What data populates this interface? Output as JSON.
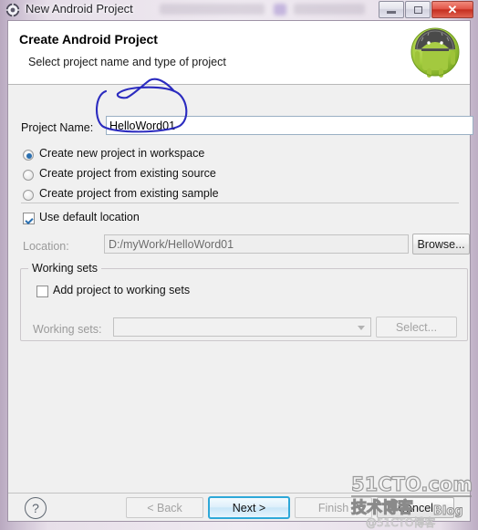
{
  "window": {
    "title": "New Android Project",
    "icon": "android-settings-icon",
    "controls": {
      "minimize": "minimize-button",
      "maximize": "maximize-button",
      "close": "✕"
    }
  },
  "header": {
    "title": "Create Android Project",
    "subtitle": "Select project name and type of project",
    "logo": "android-robot-icon"
  },
  "form": {
    "project_name_label": "Project Name:",
    "project_name_value": "HelloWord01",
    "project_name_placeholder": "",
    "radios": [
      {
        "label": "Create new project in workspace",
        "selected": true
      },
      {
        "label": "Create project from existing source",
        "selected": false
      },
      {
        "label": "Create project from existing sample",
        "selected": false
      }
    ],
    "use_default_location_label": "Use default location",
    "use_default_location_checked": true,
    "location_label": "Location:",
    "location_value": "D:/myWork/HelloWord01",
    "browse_label": "Browse...",
    "working_sets": {
      "group_title": "Working sets",
      "add_checkbox_label": "Add project to working sets",
      "add_checkbox_checked": false,
      "combo_label": "Working sets:",
      "combo_value": "",
      "select_label": "Select..."
    }
  },
  "footer": {
    "help": "?",
    "back_label": "< Back",
    "next_label": "Next >",
    "finish_label": "Finish",
    "cancel_label": "Cancel"
  },
  "watermark": {
    "line1": "51CTO.com",
    "line2": "技术博客",
    "line3": "Blog",
    "line4": "@51CTO博客"
  },
  "annotation": {
    "type": "hand-drawn-ellipse",
    "color": "#2b2bbf"
  },
  "colors": {
    "accent": "#2a6fb0",
    "next_border": "#2ea8d8",
    "android_green": "#9ccc3c",
    "frame": "#9f93a6"
  }
}
